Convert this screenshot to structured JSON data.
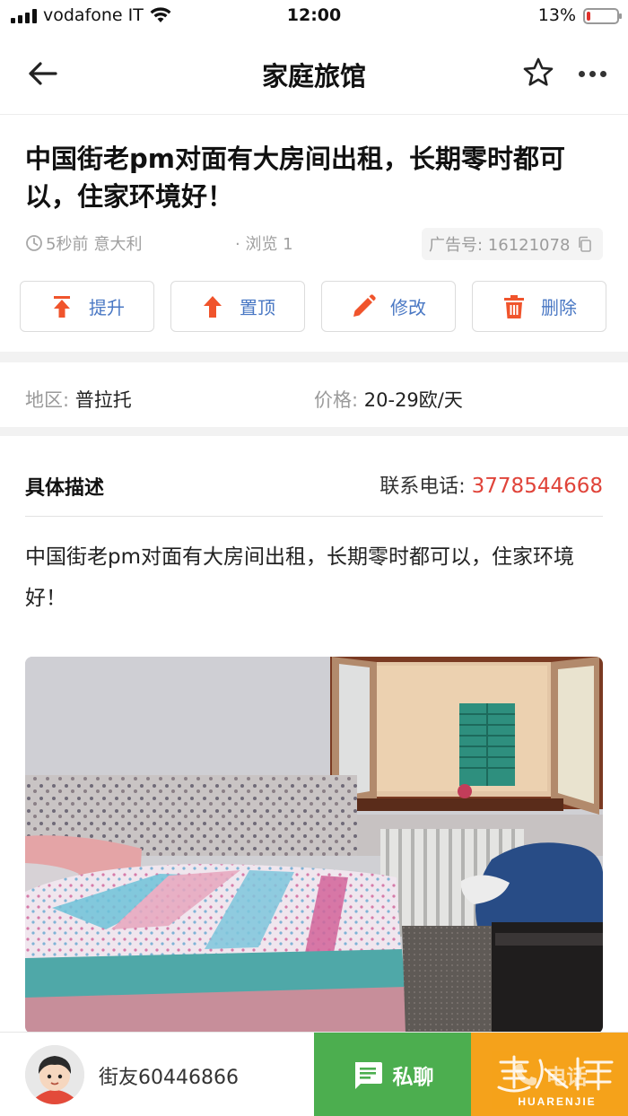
{
  "status_bar": {
    "carrier": "vodafone IT",
    "time": "12:00",
    "battery_percent_label": "13%",
    "battery_level": 0.13
  },
  "nav": {
    "title": "家庭旅馆",
    "back_icon": "back-arrow-icon",
    "favorite_icon": "star-icon",
    "more_icon": "more-dots-icon"
  },
  "post": {
    "title": "中国街老pm对面有大房间出租，长期零时都可以，住家环境好！",
    "posted_ago": "5秒前",
    "location": "意大利",
    "views": "· 浏览 1",
    "ad_number": "广告号: 16121078"
  },
  "actions": [
    {
      "label": "提升",
      "icon": "boost-icon"
    },
    {
      "label": "置顶",
      "icon": "pin-top-icon"
    },
    {
      "label": "修改",
      "icon": "pencil-icon"
    },
    {
      "label": "删除",
      "icon": "trash-icon"
    }
  ],
  "info": {
    "area_label": "地区: ",
    "area_value": "普拉托",
    "price_label": "价格: ",
    "price_value": "20-29欧/天"
  },
  "description": {
    "heading": "具体描述",
    "phone_label": "联系电话: ",
    "phone_number": "3778544668",
    "body": "中国街老pm对面有大房间出租，长期零时都可以，住家环境好！"
  },
  "bottom_bar": {
    "username": "街友60446866",
    "chat_label": "私聊",
    "call_label": "电话",
    "watermark_text": "華人街 HUARENJIE"
  },
  "colors": {
    "accent_blue": "#4a78c4",
    "icon_red": "#f0542c",
    "phone_red": "#e0443a",
    "chat_green": "#4cae4f",
    "call_orange": "#f5a21b"
  }
}
